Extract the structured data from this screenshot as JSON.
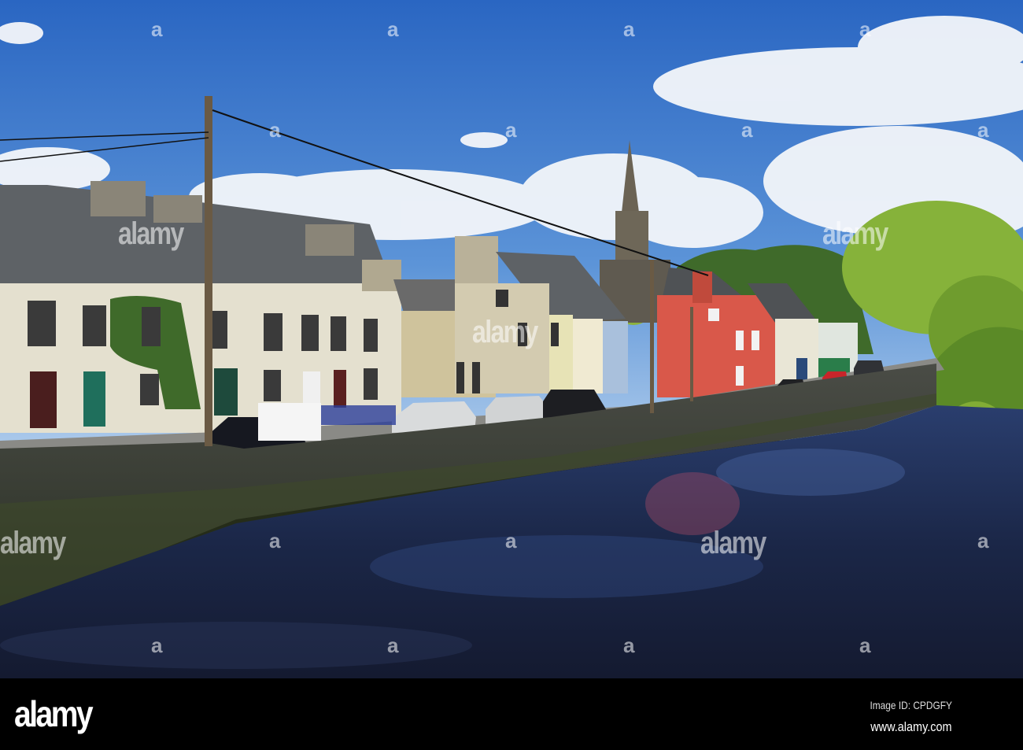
{
  "watermark": {
    "text": "alamy",
    "mark": "a"
  },
  "footer": {
    "logo": "alamy",
    "image_id": "Image ID: CPDGFY",
    "website": "www.alamy.com"
  }
}
